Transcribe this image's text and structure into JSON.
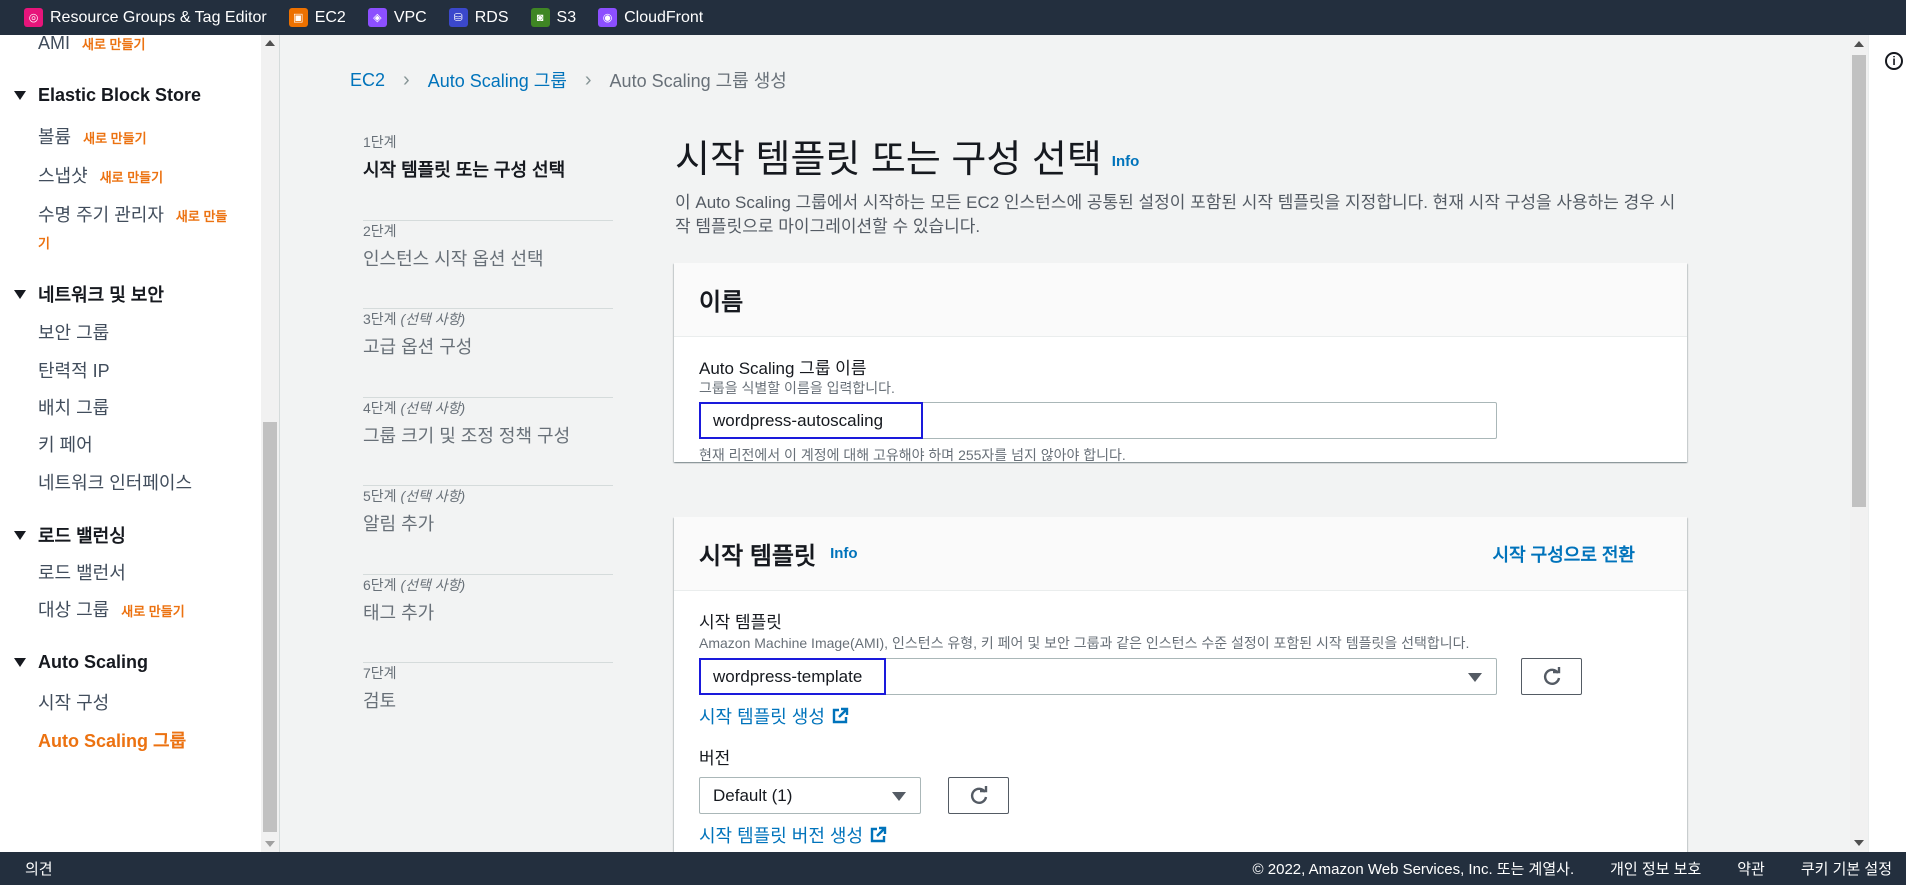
{
  "favorites": [
    {
      "label": "Resource Groups & Tag Editor",
      "icon": "resource-groups-icon",
      "color": "#e7157b"
    },
    {
      "label": "EC2",
      "icon": "ec2-icon",
      "color": "#ed7100"
    },
    {
      "label": "VPC",
      "icon": "vpc-icon",
      "color": "#8c4fff"
    },
    {
      "label": "RDS",
      "icon": "rds-icon",
      "color": "#3b48cc"
    },
    {
      "label": "S3",
      "icon": "s3-icon",
      "color": "#3f8624"
    },
    {
      "label": "CloudFront",
      "icon": "cloudfront-icon",
      "color": "#8c4fff"
    }
  ],
  "sidebar": {
    "ami": {
      "label": "AMI",
      "badge": "새로 만들기"
    },
    "ebs": {
      "title": "Elastic Block Store",
      "items": [
        {
          "label": "볼륨",
          "badge": "새로 만들기"
        },
        {
          "label": "스냅샷",
          "badge": "새로 만들기"
        },
        {
          "label": "수명 주기 관리자",
          "badge": "새로 만들",
          "badge2": "기"
        }
      ]
    },
    "network": {
      "title": "네트워크 및 보안",
      "items": [
        {
          "label": "보안 그룹"
        },
        {
          "label": "탄력적 IP"
        },
        {
          "label": "배치 그룹"
        },
        {
          "label": "키 페어"
        },
        {
          "label": "네트워크 인터페이스"
        }
      ]
    },
    "lb": {
      "title": "로드 밸런싱",
      "items": [
        {
          "label": "로드 밸런서"
        },
        {
          "label": "대상 그룹",
          "badge": "새로 만들기"
        }
      ]
    },
    "asg": {
      "title": "Auto Scaling",
      "items": [
        {
          "label": "시작 구성"
        },
        {
          "label": "Auto Scaling 그룹"
        }
      ]
    }
  },
  "breadcrumb": {
    "ec2": "EC2",
    "asg": "Auto Scaling 그룹",
    "current": "Auto Scaling 그룹 생성"
  },
  "steps": [
    {
      "num": "1단계",
      "optional": "",
      "title": "시작 템플릿 또는 구성 선택",
      "current": true
    },
    {
      "num": "2단계",
      "optional": "",
      "title": "인스턴스 시작 옵션 선택"
    },
    {
      "num": "3단계",
      "optional": "(선택 사항)",
      "title": "고급 옵션 구성"
    },
    {
      "num": "4단계",
      "optional": "(선택 사항)",
      "title": "그룹 크기 및 조정 정책 구성"
    },
    {
      "num": "5단계",
      "optional": "(선택 사항)",
      "title": "알림 추가"
    },
    {
      "num": "6단계",
      "optional": "(선택 사항)",
      "title": "태그 추가"
    },
    {
      "num": "7단계",
      "optional": "",
      "title": "검토"
    }
  ],
  "page": {
    "title": "시작 템플릿 또는 구성 선택",
    "info": "Info",
    "description": "이 Auto Scaling 그룹에서 시작하는 모든 EC2 인스턴스에 공통된 설정이 포함된 시작 템플릿을 지정합니다. 현재 시작 구성을 사용하는 경우 시작 템플릿으로 마이그레이션할 수 있습니다."
  },
  "name_card": {
    "title": "이름",
    "label": "Auto Scaling 그룹 이름",
    "hint": "그룹을 식별할 이름을 입력합니다.",
    "value": "wordpress-autoscaling",
    "constraint": "현재 리전에서 이 계정에 대해 고유해야 하며 255자를 넘지 않아야 합니다."
  },
  "template_card": {
    "title": "시작 템플릿",
    "info": "Info",
    "switch": "시작 구성으로 전환",
    "label": "시작 템플릿",
    "hint": "Amazon Machine Image(AMI), 인스턴스 유형, 키 페어 및 보안 그룹과 같은 인스턴스 수준 설정이 포함된 시작 템플릿을 선택합니다.",
    "value": "wordpress-template",
    "create_link": "시작 템플릿 생성",
    "version_label": "버전",
    "version_value": "Default (1)",
    "create_version_link": "시작 템플릿 버전 생성"
  },
  "footer": {
    "feedback": "의견",
    "copyright": "© 2022, Amazon Web Services, Inc. 또는 계열사.",
    "privacy": "개인 정보 보호",
    "terms": "약관",
    "cookies": "쿠키 기본 설정"
  }
}
